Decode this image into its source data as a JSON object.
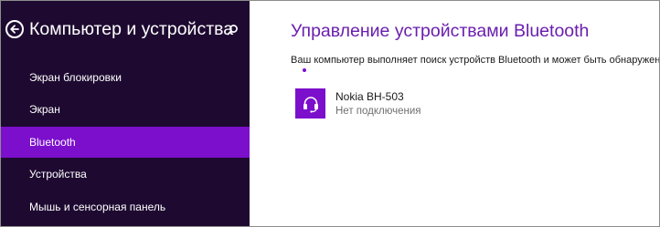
{
  "sidebar": {
    "title": "Компьютер и устройства",
    "back_icon": "back-arrow-icon",
    "search_icon": "search-icon",
    "items": [
      {
        "label": "Экран блокировки",
        "selected": false
      },
      {
        "label": "Экран",
        "selected": false
      },
      {
        "label": "Bluetooth",
        "selected": true
      },
      {
        "label": "Устройства",
        "selected": false
      },
      {
        "label": "Мышь и сенсорная панель",
        "selected": false
      }
    ]
  },
  "main": {
    "title": "Управление устройствами Bluetooth",
    "status": "Ваш компьютер выполняет поиск устройств Bluetooth и может быть обнаружен ими.",
    "devices": [
      {
        "name": "Nokia BH-503",
        "status": "Нет подключения",
        "icon": "headset-icon"
      }
    ]
  },
  "colors": {
    "sidebar_bg": "#1e0a31",
    "accent": "#7c0fcc",
    "title_text": "#6a1eae",
    "secondary_text": "#707070"
  }
}
